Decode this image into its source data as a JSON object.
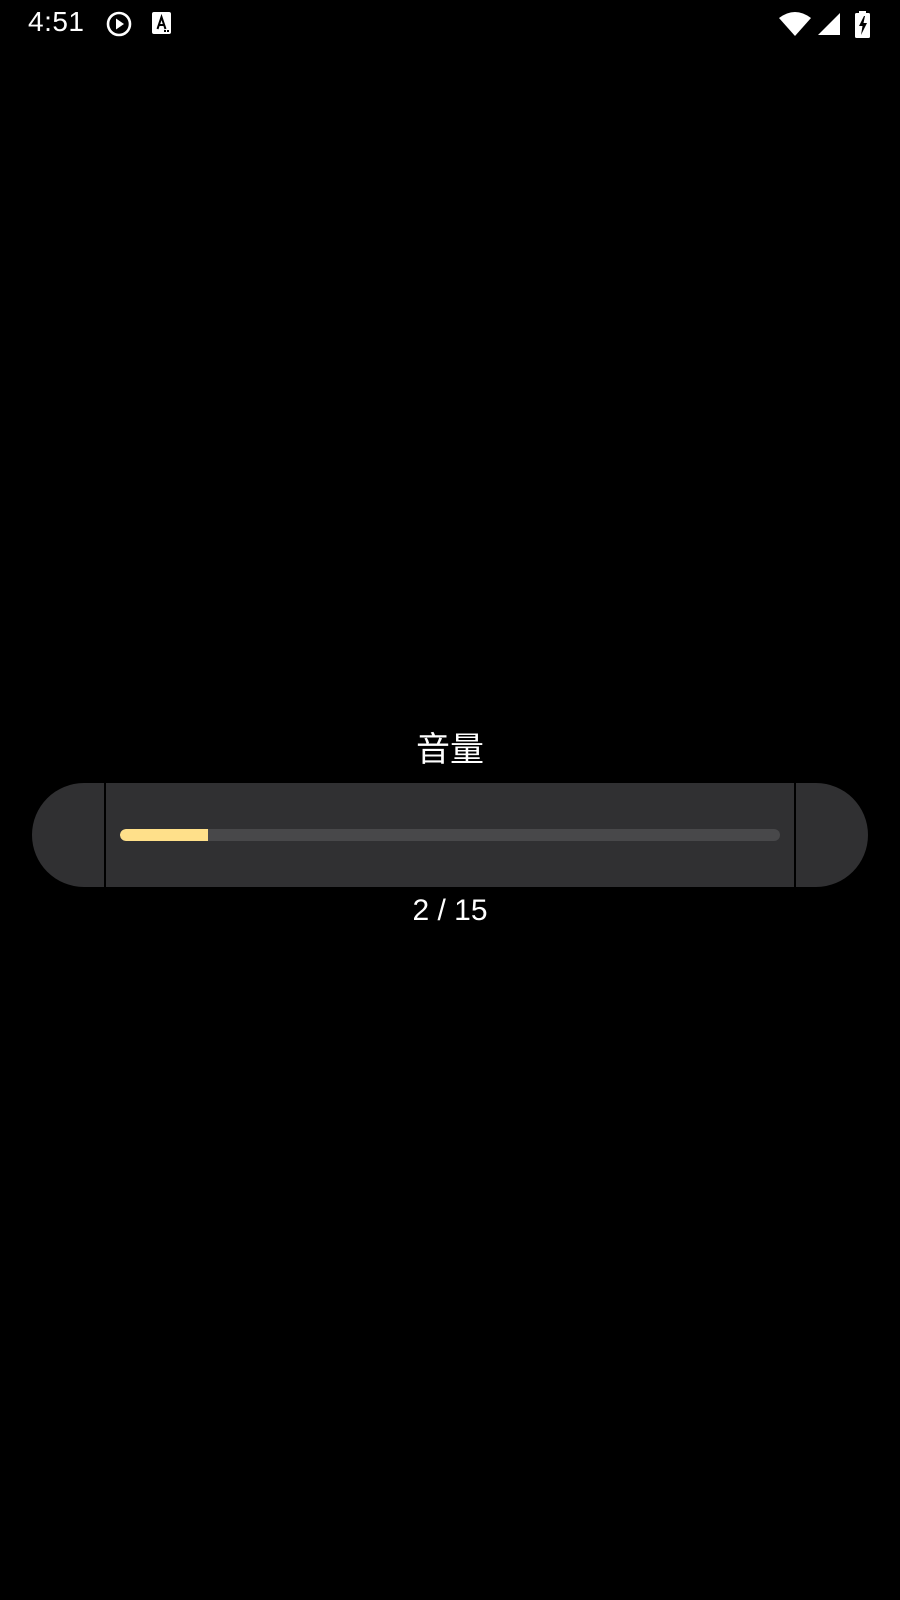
{
  "status_bar": {
    "time": "4:51",
    "left_icons": [
      "play-circle-icon",
      "text-a-icon"
    ],
    "right_icons": [
      "wifi-icon",
      "cell-signal-icon",
      "battery-charging-icon"
    ]
  },
  "volume": {
    "title": "音量",
    "current": 2,
    "max": 15,
    "readout": "2 / 15",
    "fill_color": "#ffe08a"
  },
  "colors": {
    "background": "#000000",
    "panel": "#303032",
    "track": "#48484a",
    "accent": "#ffe08a"
  }
}
